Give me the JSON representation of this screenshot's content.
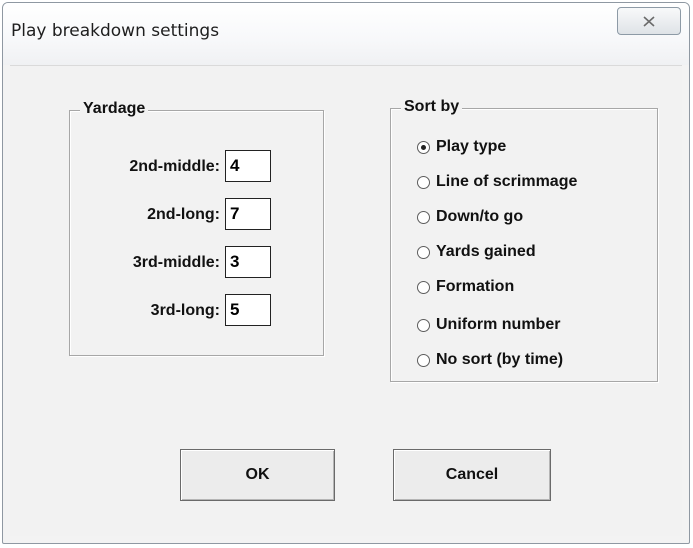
{
  "window": {
    "title": "Play breakdown settings",
    "close_icon": "close-x-icon"
  },
  "yardage": {
    "legend": "Yardage",
    "fields": [
      {
        "label": "2nd-middle:",
        "value": "4"
      },
      {
        "label": "2nd-long:",
        "value": "7"
      },
      {
        "label": "3rd-middle:",
        "value": "3"
      },
      {
        "label": "3rd-long:",
        "value": "5"
      }
    ]
  },
  "sort": {
    "legend": "Sort by",
    "options": [
      {
        "label": "Play type",
        "checked": true
      },
      {
        "label": "Line of scrimmage",
        "checked": false
      },
      {
        "label": "Down/to go",
        "checked": false
      },
      {
        "label": "Yards gained",
        "checked": false
      },
      {
        "label": "Formation",
        "checked": false
      },
      {
        "label": "Uniform number",
        "checked": false
      },
      {
        "label": "No sort (by time)",
        "checked": false
      }
    ]
  },
  "buttons": {
    "ok": "OK",
    "cancel": "Cancel"
  }
}
